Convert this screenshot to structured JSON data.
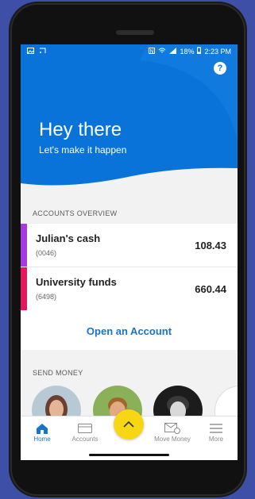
{
  "status_bar": {
    "battery": "18%",
    "time": "2:23 PM"
  },
  "hero": {
    "greeting": "Hey there",
    "subtitle": "Let's make it happen",
    "help_icon_glyph": "?"
  },
  "accounts_overview": {
    "title": "ACCOUNTS OVERVIEW",
    "accounts": [
      {
        "name": "Julian's cash",
        "number": "(0046)",
        "balance": "108.43",
        "color": "#a63be0"
      },
      {
        "name": "University funds",
        "number": "(6498)",
        "balance": "660.44",
        "color": "#e8175d"
      }
    ],
    "open_account_label": "Open an Account"
  },
  "send_money": {
    "title": "SEND MONEY"
  },
  "bottom_nav": {
    "items": [
      {
        "label": "Home",
        "icon": "home-icon"
      },
      {
        "label": "Accounts",
        "icon": "card-icon"
      },
      {
        "label": "Move Money",
        "icon": "envelope-icon"
      },
      {
        "label": "More",
        "icon": "menu-icon"
      }
    ]
  },
  "colors": {
    "brand_blue": "#0a73d9",
    "fab_yellow": "#f7d614",
    "link_blue": "#1a73c9"
  }
}
